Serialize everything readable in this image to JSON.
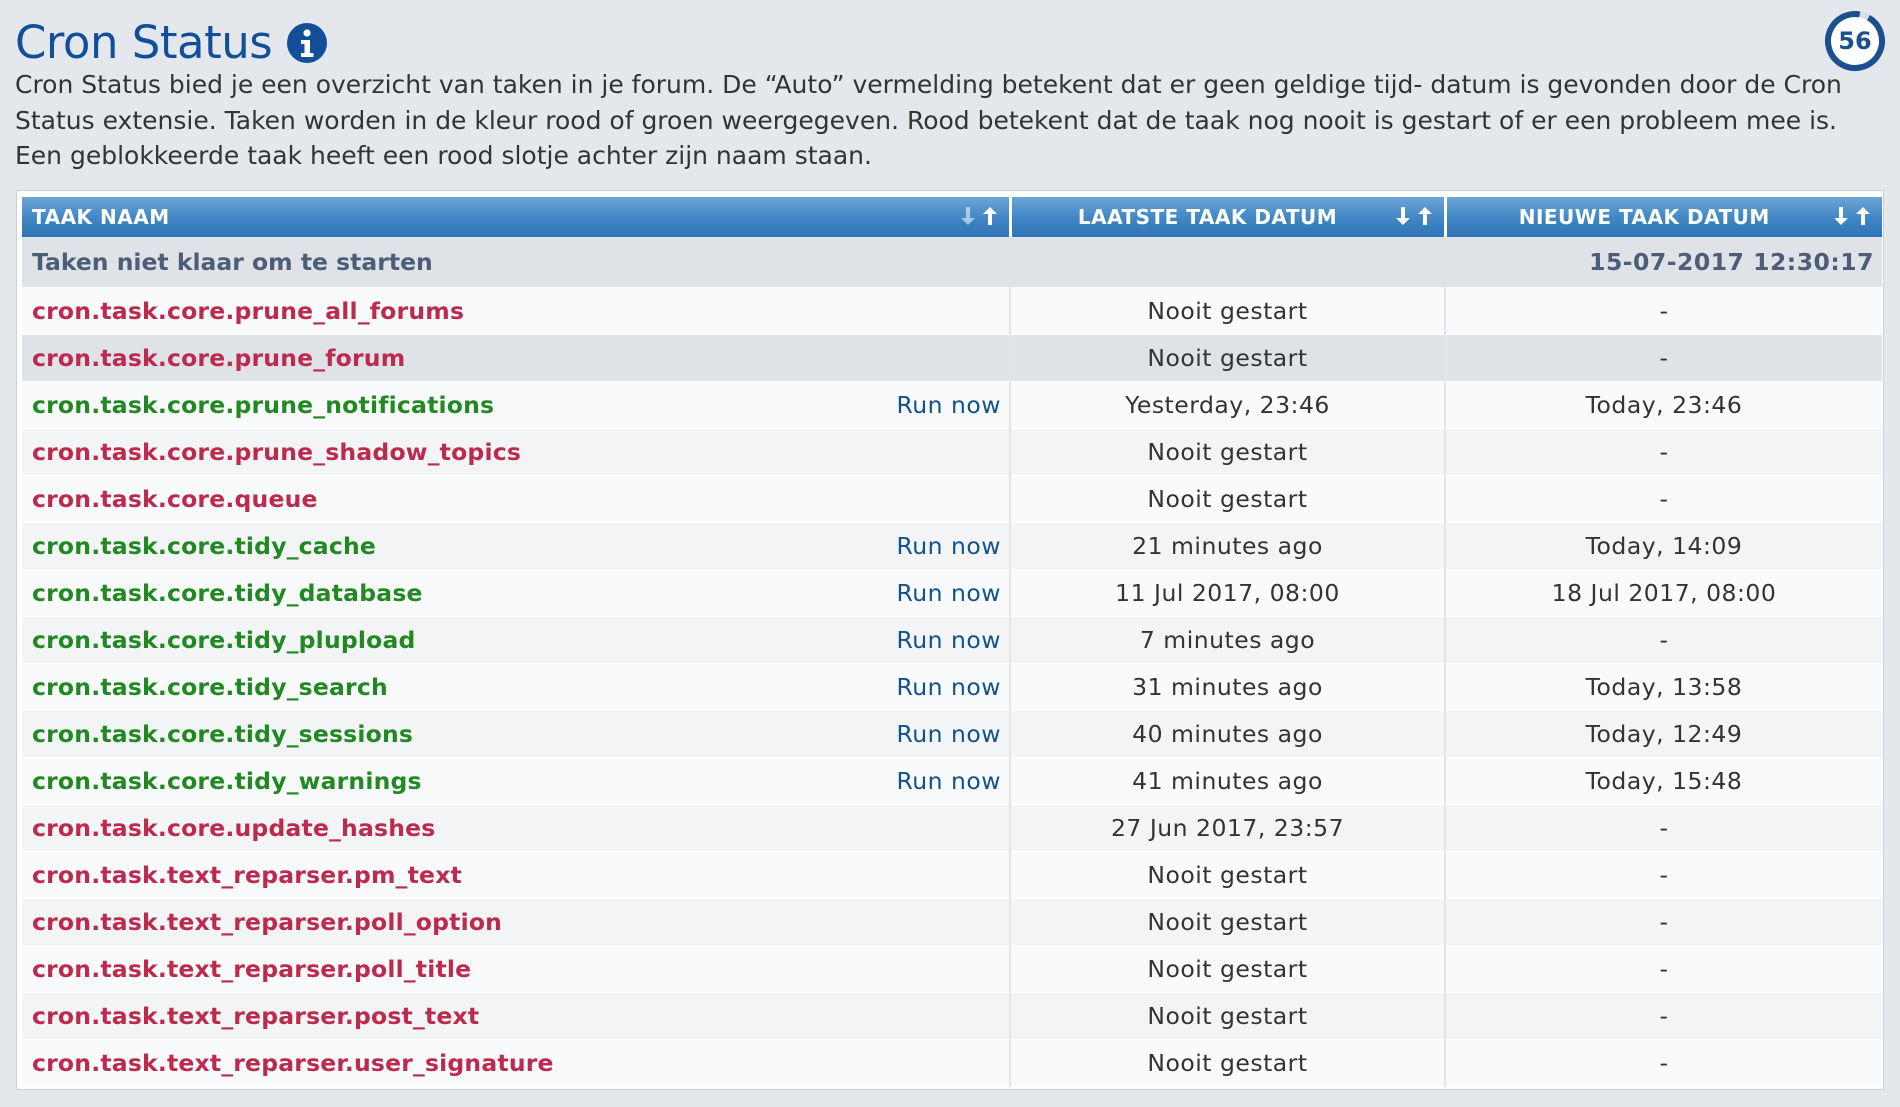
{
  "page": {
    "title": "Cron Status",
    "info_icon": "info-circle-icon",
    "counter": "56",
    "description": "Cron Status bied je een overzicht van taken in je forum. De “Auto” vermelding betekent dat er geen geldige tijd- datum is gevonden door de Cron Status extensie. Taken worden in de kleur rood of groen weergegeven. Rood betekent dat de taak nog nooit is gestart of er een probleem mee is. Een geblokkeerde taak heeft een rood slotje achter zijn naam staan."
  },
  "colors": {
    "title": "#115098",
    "header_bg": "#3f86c4",
    "status_red": "#bc2a4d",
    "status_green": "#228822",
    "link": "#105289"
  },
  "table": {
    "headers": {
      "name": "TAAK NAAM",
      "last": "LAATSTE TAAK DATUM",
      "next": "NIEUWE TAAK DATUM"
    },
    "sort_icons": [
      "arrow-down-icon",
      "arrow-up-icon"
    ],
    "group": {
      "label": "Taken niet klaar om te starten",
      "date": "15-07-2017 12:30:17"
    },
    "run_now_label": "Run now",
    "rows": [
      {
        "name": "cron.task.core.prune_all_forums",
        "status": "red",
        "run_now": "",
        "last": "Nooit gestart",
        "next": "-"
      },
      {
        "name": "cron.task.core.prune_forum",
        "status": "red",
        "run_now": "",
        "last": "Nooit gestart",
        "next": "-"
      },
      {
        "name": "cron.task.core.prune_notifications",
        "status": "green",
        "run_now": "Run now",
        "last": "Yesterday, 23:46",
        "next": "Today, 23:46"
      },
      {
        "name": "cron.task.core.prune_shadow_topics",
        "status": "red",
        "run_now": "",
        "last": "Nooit gestart",
        "next": "-"
      },
      {
        "name": "cron.task.core.queue",
        "status": "red",
        "run_now": "",
        "last": "Nooit gestart",
        "next": "-"
      },
      {
        "name": "cron.task.core.tidy_cache",
        "status": "green",
        "run_now": "Run now",
        "last": "21 minutes ago",
        "next": "Today, 14:09"
      },
      {
        "name": "cron.task.core.tidy_database",
        "status": "green",
        "run_now": "Run now",
        "last": "11 Jul 2017, 08:00",
        "next": "18 Jul 2017, 08:00"
      },
      {
        "name": "cron.task.core.tidy_plupload",
        "status": "green",
        "run_now": "Run now",
        "last": "7 minutes ago",
        "next": "-"
      },
      {
        "name": "cron.task.core.tidy_search",
        "status": "green",
        "run_now": "Run now",
        "last": "31 minutes ago",
        "next": "Today, 13:58"
      },
      {
        "name": "cron.task.core.tidy_sessions",
        "status": "green",
        "run_now": "Run now",
        "last": "40 minutes ago",
        "next": "Today, 12:49"
      },
      {
        "name": "cron.task.core.tidy_warnings",
        "status": "green",
        "run_now": "Run now",
        "last": "41 minutes ago",
        "next": "Today, 15:48"
      },
      {
        "name": "cron.task.core.update_hashes",
        "status": "red",
        "run_now": "",
        "last": "27 Jun 2017, 23:57",
        "next": "-"
      },
      {
        "name": "cron.task.text_reparser.pm_text",
        "status": "red",
        "run_now": "",
        "last": "Nooit gestart",
        "next": "-"
      },
      {
        "name": "cron.task.text_reparser.poll_option",
        "status": "red",
        "run_now": "",
        "last": "Nooit gestart",
        "next": "-"
      },
      {
        "name": "cron.task.text_reparser.poll_title",
        "status": "red",
        "run_now": "",
        "last": "Nooit gestart",
        "next": "-"
      },
      {
        "name": "cron.task.text_reparser.post_text",
        "status": "red",
        "run_now": "",
        "last": "Nooit gestart",
        "next": "-"
      },
      {
        "name": "cron.task.text_reparser.user_signature",
        "status": "red",
        "run_now": "",
        "last": "Nooit gestart",
        "next": "-"
      }
    ]
  }
}
